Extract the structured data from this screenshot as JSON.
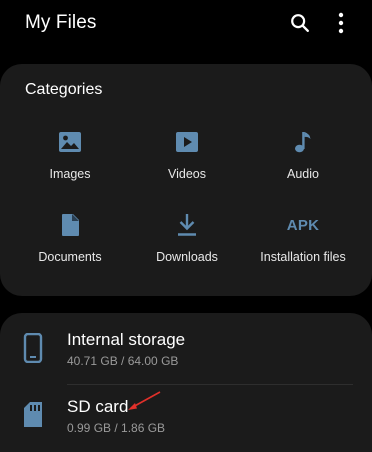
{
  "header": {
    "title": "My Files",
    "search_icon": "search-icon",
    "more_icon": "more-vertical-icon"
  },
  "categories": {
    "title": "Categories",
    "items": [
      {
        "label": "Images",
        "icon": "image-icon"
      },
      {
        "label": "Videos",
        "icon": "video-icon"
      },
      {
        "label": "Audio",
        "icon": "music-note-icon"
      },
      {
        "label": "Documents",
        "icon": "document-icon"
      },
      {
        "label": "Downloads",
        "icon": "download-icon"
      },
      {
        "label": "Installation files",
        "icon": "apk-icon",
        "icon_text": "APK"
      }
    ]
  },
  "storage": {
    "items": [
      {
        "name": "Internal storage",
        "size": "40.71 GB / 64.00 GB",
        "icon": "phone-icon"
      },
      {
        "name": "SD card",
        "size": "0.99 GB / 1.86 GB",
        "icon": "sd-card-icon"
      }
    ]
  },
  "colors": {
    "background": "#000000",
    "card": "#1b1b1b",
    "icon_accent": "#5f8bb0",
    "annotation_arrow": "#e0302a"
  }
}
